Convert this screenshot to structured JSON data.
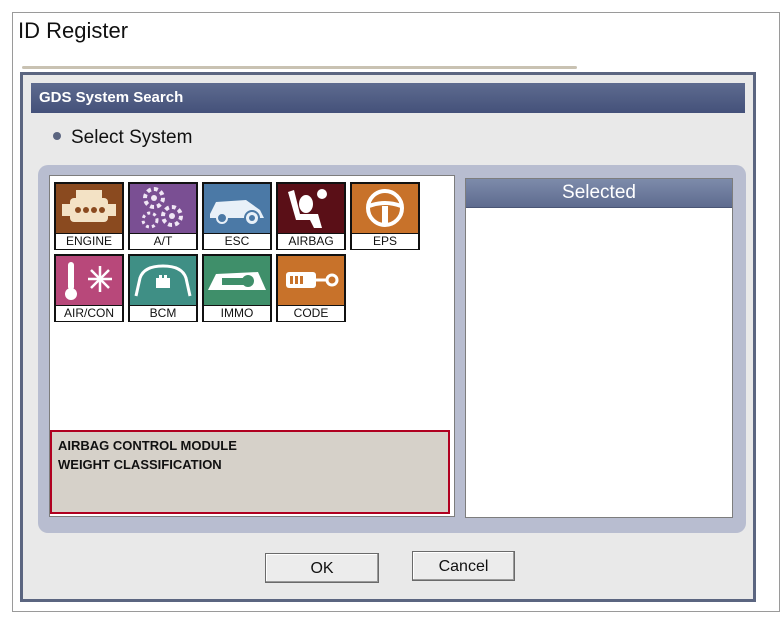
{
  "window": {
    "title": "ID Register"
  },
  "dialog": {
    "title": "GDS System Search",
    "section_label": "Select System",
    "selected_header": "Selected",
    "description_lines": [
      "AIRBAG CONTROL MODULE",
      "WEIGHT CLASSIFICATION"
    ],
    "ok_label": "OK",
    "cancel_label": "Cancel"
  },
  "systems": [
    {
      "label": "ENGINE",
      "icon": "engine-icon",
      "color": "#8a4a1f"
    },
    {
      "label": "A/T",
      "icon": "gears-icon",
      "color": "#7a4f93"
    },
    {
      "label": "ESC",
      "icon": "car-icon",
      "color": "#4b79a6"
    },
    {
      "label": "AIRBAG",
      "icon": "airbag-seat-icon",
      "color": "#5a0f17"
    },
    {
      "label": "EPS",
      "icon": "steering-wheel-icon",
      "color": "#c8722a"
    },
    {
      "label": "AIR/CON",
      "icon": "air-conditioning-icon",
      "color": "#b8487a"
    },
    {
      "label": "BCM",
      "icon": "body-control-icon",
      "color": "#3f8f85"
    },
    {
      "label": "IMMO",
      "icon": "immobilizer-key-icon",
      "color": "#3f8f6a"
    },
    {
      "label": "CODE",
      "icon": "key-fob-icon",
      "color": "#c8722a"
    }
  ]
}
